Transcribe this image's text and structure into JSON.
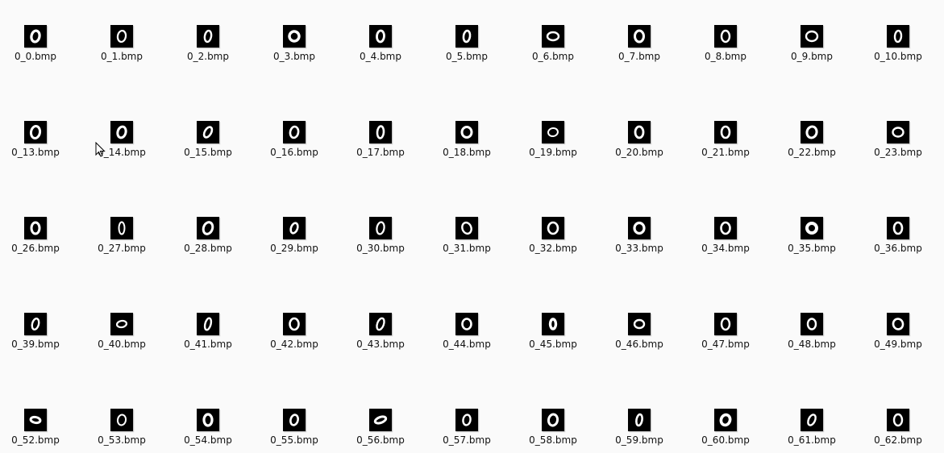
{
  "files": [
    [
      "0_0.bmp",
      "0_1.bmp",
      "0_2.bmp",
      "0_3.bmp",
      "0_4.bmp",
      "0_5.bmp",
      "0_6.bmp",
      "0_7.bmp",
      "0_8.bmp",
      "0_9.bmp",
      "0_10.bmp"
    ],
    [
      "0_13.bmp",
      "0_14.bmp",
      "0_15.bmp",
      "0_16.bmp",
      "0_17.bmp",
      "0_18.bmp",
      "0_19.bmp",
      "0_20.bmp",
      "0_21.bmp",
      "0_22.bmp",
      "0_23.bmp"
    ],
    [
      "0_26.bmp",
      "0_27.bmp",
      "0_28.bmp",
      "0_29.bmp",
      "0_30.bmp",
      "0_31.bmp",
      "0_32.bmp",
      "0_33.bmp",
      "0_34.bmp",
      "0_35.bmp",
      "0_36.bmp"
    ],
    [
      "0_39.bmp",
      "0_40.bmp",
      "0_41.bmp",
      "0_42.bmp",
      "0_43.bmp",
      "0_44.bmp",
      "0_45.bmp",
      "0_46.bmp",
      "0_47.bmp",
      "0_48.bmp",
      "0_49.bmp"
    ],
    [
      "0_52.bmp",
      "0_53.bmp",
      "0_54.bmp",
      "0_55.bmp",
      "0_56.bmp",
      "0_57.bmp",
      "0_58.bmp",
      "0_59.bmp",
      "0_60.bmp",
      "0_61.bmp",
      "0_62.bmp"
    ]
  ],
  "thumbnail_icon": "handwritten-zero-digit-thumbnail",
  "cursor_icon": "mouse-pointer-icon",
  "colors": {
    "background": "#fafafa",
    "thumbnail_bg": "#000000",
    "digit_stroke": "#ffffff",
    "text": "#111111"
  }
}
